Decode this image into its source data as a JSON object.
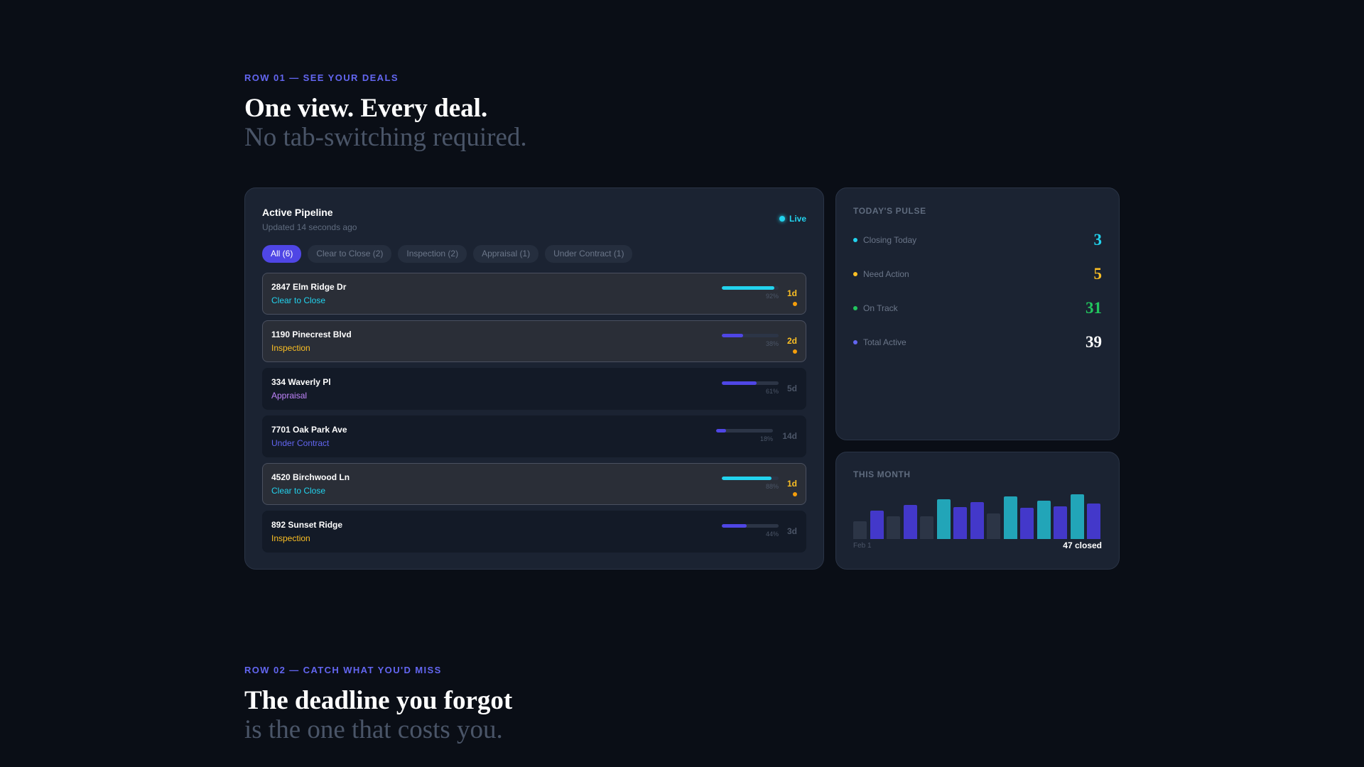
{
  "row1": {
    "eyebrow": "ROW 01 — SEE YOUR DEALS",
    "headline": "One view. Every deal.",
    "subhead": "No tab-switching required."
  },
  "pipeline": {
    "title": "Active Pipeline",
    "updated": "Updated 14 seconds ago",
    "live_label": "Live",
    "filters": [
      {
        "label": "All (6)",
        "active": true
      },
      {
        "label": "Clear to Close (2)",
        "active": false
      },
      {
        "label": "Inspection (2)",
        "active": false
      },
      {
        "label": "Appraisal (1)",
        "active": false
      },
      {
        "label": "Under Contract (1)",
        "active": false
      }
    ],
    "deals": [
      {
        "address": "2847 Elm Ridge Dr",
        "stage": "Clear to Close",
        "stage_color": "#22d3ee",
        "progress": 92,
        "progress_label": "92%",
        "bar_color": "#22d3ee",
        "days": "1d",
        "urgent": true,
        "highlighted": true
      },
      {
        "address": "1190 Pinecrest Blvd",
        "stage": "Inspection",
        "stage_color": "#fbbf24",
        "progress": 38,
        "progress_label": "38%",
        "bar_color": "#4f46e5",
        "days": "2d",
        "urgent": true,
        "highlighted": true
      },
      {
        "address": "334 Waverly Pl",
        "stage": "Appraisal",
        "stage_color": "#c084fc",
        "progress": 61,
        "progress_label": "61%",
        "bar_color": "#4f46e5",
        "days": "5d",
        "urgent": false,
        "highlighted": false
      },
      {
        "address": "7701 Oak Park Ave",
        "stage": "Under Contract",
        "stage_color": "#6366f1",
        "progress": 18,
        "progress_label": "18%",
        "bar_color": "#4f46e5",
        "days": "14d",
        "urgent": false,
        "highlighted": false
      },
      {
        "address": "4520 Birchwood Ln",
        "stage": "Clear to Close",
        "stage_color": "#22d3ee",
        "progress": 88,
        "progress_label": "88%",
        "bar_color": "#22d3ee",
        "days": "1d",
        "urgent": true,
        "highlighted": true
      },
      {
        "address": "892 Sunset Ridge",
        "stage": "Inspection",
        "stage_color": "#fbbf24",
        "progress": 44,
        "progress_label": "44%",
        "bar_color": "#4f46e5",
        "days": "3d",
        "urgent": false,
        "highlighted": false
      }
    ]
  },
  "pulse": {
    "label": "TODAY'S PULSE",
    "stats": [
      {
        "label": "Closing Today",
        "value": "3",
        "color": "#22d3ee",
        "dot_color": "#22d3ee"
      },
      {
        "label": "Need Action",
        "value": "5",
        "color": "#fbbf24",
        "dot_color": "#fbbf24"
      },
      {
        "label": "On Track",
        "value": "31",
        "color": "#22c55e",
        "dot_color": "#22c55e"
      },
      {
        "label": "Total Active",
        "value": "39",
        "color": "#ffffff",
        "dot_color": "#6366f1"
      }
    ]
  },
  "month": {
    "label": "THIS MONTH",
    "start_label": "Feb 1",
    "closed_label": "47 closed",
    "bars": [
      {
        "value": 0.35,
        "kind": "muted"
      },
      {
        "value": 0.56,
        "kind": "indigo"
      },
      {
        "value": 0.44,
        "kind": "muted"
      },
      {
        "value": 0.67,
        "kind": "indigo"
      },
      {
        "value": 0.44,
        "kind": "muted"
      },
      {
        "value": 0.78,
        "kind": "cyan"
      },
      {
        "value": 0.62,
        "kind": "indigo"
      },
      {
        "value": 0.72,
        "kind": "indigo"
      },
      {
        "value": 0.5,
        "kind": "muted"
      },
      {
        "value": 0.83,
        "kind": "cyan"
      },
      {
        "value": 0.61,
        "kind": "indigo"
      },
      {
        "value": 0.75,
        "kind": "cyan"
      },
      {
        "value": 0.64,
        "kind": "indigo"
      },
      {
        "value": 0.87,
        "kind": "cyan"
      },
      {
        "value": 0.7,
        "kind": "indigo"
      }
    ],
    "colors": {
      "muted": "#2c3546",
      "indigo": "#4338ca",
      "cyan": "#22a5b8"
    }
  },
  "row2": {
    "eyebrow": "ROW 02 — CATCH WHAT YOU'D MISS",
    "headline": "The deadline you forgot",
    "subhead": "is the one that costs you."
  }
}
